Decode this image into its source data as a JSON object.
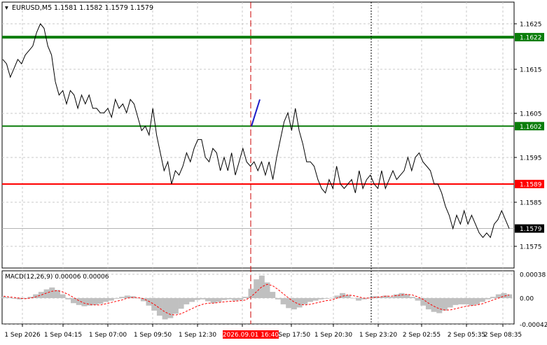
{
  "header": {
    "symbol": "EURUSD,M5",
    "ohlc": "1.1581 1.1582 1.1579 1.1579"
  },
  "macd": {
    "label": "MACD(12,26,9) 0.00006 0.00006",
    "yticks": [
      {
        "value": 0.00038,
        "label": "0.00038"
      },
      {
        "value": 0.0,
        "label": "0.00"
      },
      {
        "value": -0.00042,
        "label": "-0.00042"
      }
    ]
  },
  "colors": {
    "price_line": "#000000",
    "level_green": "#0a7d0a",
    "level_red": "#ff0000",
    "marker_red": "#cc0000",
    "impulse": "#1c1cc8",
    "macd_hist": "#c0c0c0",
    "macd_signal": "#ff0000",
    "grid": "#c8c8c8",
    "tag_highlight": "#ff0000"
  },
  "chart_data": [
    {
      "type": "line",
      "title": "EURUSD,M5",
      "ylim": [
        1.1571,
        1.1629
      ],
      "grid": true,
      "yticks": [
        "1.1625",
        "1.1615",
        "1.1605",
        "1.1595",
        "1.1585",
        "1.1575"
      ],
      "xticks": [
        "1 Sep 2026",
        "1 Sep 04:15",
        "1 Sep 07:00",
        "1 Sep 09:50",
        "1 Sep 12:30",
        "1 Sep 15:10",
        "1 Sep 17:50",
        "1 Sep 20:30",
        "1 Sep 23:20",
        "2 Sep 02:55",
        "2 Sep 05:35",
        "2 Sep 08:35"
      ],
      "time_marker": {
        "label": "2026.09.01 16:40",
        "tick_index": 5
      },
      "crosshair_tick_index": 8,
      "levels": [
        {
          "value": 1.1622,
          "label": "1.1622",
          "color": "green",
          "weight": "thick"
        },
        {
          "value": 1.1602,
          "label": "1.1602",
          "color": "green",
          "weight": "thin"
        },
        {
          "value": 1.1589,
          "label": "1.1589",
          "color": "red",
          "weight": "thin"
        },
        {
          "value": 1.1579,
          "label": "1.1579",
          "color": "current",
          "weight": "thin"
        }
      ],
      "series": [
        {
          "values": [
            1.1617,
            1.1616,
            1.1613,
            1.1615,
            1.1617,
            1.1616,
            1.1618,
            1.1619,
            1.162,
            1.1623,
            1.1625,
            1.1624,
            1.162,
            1.1618,
            1.1612,
            1.1609,
            1.161,
            1.1607,
            1.161,
            1.1609,
            1.1606,
            1.1609,
            1.1607,
            1.1609,
            1.1606,
            1.1606,
            1.1605,
            1.1605,
            1.1606,
            1.1604,
            1.1608,
            1.1606,
            1.1607,
            1.1605,
            1.1608,
            1.1607,
            1.1604,
            1.1601,
            1.1602,
            1.16,
            1.1606,
            1.16,
            1.1596,
            1.1592,
            1.1594,
            1.1589,
            1.1592,
            1.1591,
            1.1593,
            1.1596,
            1.1594,
            1.1597,
            1.1599,
            1.1599,
            1.1595,
            1.1594,
            1.1597,
            1.1596,
            1.1592,
            1.1595,
            1.1592,
            1.1596,
            1.1591,
            1.1594,
            1.1597,
            1.1594,
            1.1593,
            1.1594,
            1.1592,
            1.1594,
            1.1591,
            1.1594,
            1.159,
            1.1595,
            1.1599,
            1.1603,
            1.1605,
            1.1601,
            1.1606,
            1.1601,
            1.1598,
            1.1594,
            1.1594,
            1.1593,
            1.159,
            1.1588,
            1.1587,
            1.159,
            1.1588,
            1.1593,
            1.1589,
            1.1588,
            1.1589,
            1.159,
            1.1587,
            1.1592,
            1.1588,
            1.159,
            1.1591,
            1.1589,
            1.1588,
            1.1592,
            1.1588,
            1.159,
            1.1592,
            1.159,
            1.1591,
            1.1592,
            1.1595,
            1.1592,
            1.1595,
            1.1596,
            1.1594,
            1.1593,
            1.1592,
            1.1589,
            1.1589,
            1.1587,
            1.1584,
            1.1582,
            1.1579,
            1.1582,
            1.158,
            1.1583,
            1.158,
            1.1582,
            1.158,
            1.1578,
            1.1577,
            1.1578,
            1.1577,
            1.158,
            1.1581,
            1.1583,
            1.1581,
            1.1579
          ]
        },
        {
          "name": "",
          "values": [
            1.1602,
            1.1608
          ]
        }
      ]
    },
    {
      "type": "bar",
      "title": "MACD(12,26,9)",
      "ylim": [
        -0.00045,
        0.00045
      ],
      "series": [
        {
          "name": "MACD",
          "values": [
            2e-05,
            1e-05,
            -1e-05,
            -2e-05,
            -1e-05,
            2e-05,
            6e-05,
            0.0001,
            0.00014,
            0.00017,
            0.00013,
            6e-05,
            -2e-05,
            -8e-05,
            -0.00011,
            -0.00013,
            -0.00012,
            -0.00011,
            -9e-05,
            -6e-05,
            -4e-05,
            -1e-05,
            2e-05,
            4e-05,
            3e-05,
            0.0,
            -5e-05,
            -0.00012,
            -0.0002,
            -0.00028,
            -0.00034,
            -0.00032,
            -0.00025,
            -0.00017,
            -0.0001,
            -6e-05,
            -3e-05,
            -2e-05,
            -5e-05,
            -8e-05,
            -6e-05,
            -3e-05,
            -2e-05,
            -4e-05,
            -3e-05,
            2e-05,
            0.00015,
            0.0003,
            0.00036,
            0.00025,
            0.0001,
            -2e-05,
            -0.0001,
            -0.00016,
            -0.00018,
            -0.00015,
            -0.0001,
            -6e-05,
            -4e-05,
            -2e-05,
            -1e-05,
            0.0,
            4e-05,
            8e-05,
            5e-05,
            0.0,
            -4e-05,
            -2e-05,
            1e-05,
            3e-05,
            2e-05,
            4e-05,
            2e-05,
            6e-05,
            8e-05,
            6e-05,
            2e-05,
            -4e-05,
            -0.00012,
            -0.00018,
            -0.00022,
            -0.00024,
            -0.0002,
            -0.00015,
            -0.00011,
            -0.0001,
            -0.0001,
            -0.00012,
            -0.0001,
            -6e-05,
            -2e-05,
            2e-05,
            6e-05,
            8e-05,
            6e-05
          ]
        },
        {
          "name": "Signal",
          "values": [
            3e-05,
            2e-05,
            1e-05,
            0.0,
            -1e-05,
            0.0,
            2e-05,
            5e-05,
            8e-05,
            0.00011,
            0.00012,
            0.0001,
            6e-05,
            1e-05,
            -4e-05,
            -8e-05,
            -0.0001,
            -0.00011,
            -0.00011,
            -9e-05,
            -7e-05,
            -5e-05,
            -3e-05,
            0.0,
            1e-05,
            1e-05,
            -1e-05,
            -5e-05,
            -0.0001,
            -0.00016,
            -0.00022,
            -0.00026,
            -0.00027,
            -0.00025,
            -0.00021,
            -0.00017,
            -0.00013,
            -0.0001,
            -8e-05,
            -8e-05,
            -7e-05,
            -6e-05,
            -5e-05,
            -5e-05,
            -4e-05,
            -3e-05,
            2e-05,
            0.0001,
            0.00018,
            0.00022,
            0.0002,
            0.00014,
            7e-05,
            0.0,
            -6e-05,
            -0.0001,
            -0.00011,
            -0.0001,
            -8e-05,
            -6e-05,
            -4e-05,
            -3e-05,
            0.0,
            3e-05,
            5e-05,
            4e-05,
            2e-05,
            0.0,
            0.0,
            1e-05,
            2e-05,
            3e-05,
            3e-05,
            4e-05,
            5e-05,
            6e-05,
            5e-05,
            2e-05,
            -2e-05,
            -8e-05,
            -0.00013,
            -0.00017,
            -0.00019,
            -0.00019,
            -0.00017,
            -0.00015,
            -0.00013,
            -0.00012,
            -0.00011,
            -9e-05,
            -6e-05,
            -3e-05,
            0.0,
            3e-05,
            5e-05
          ]
        }
      ]
    }
  ]
}
